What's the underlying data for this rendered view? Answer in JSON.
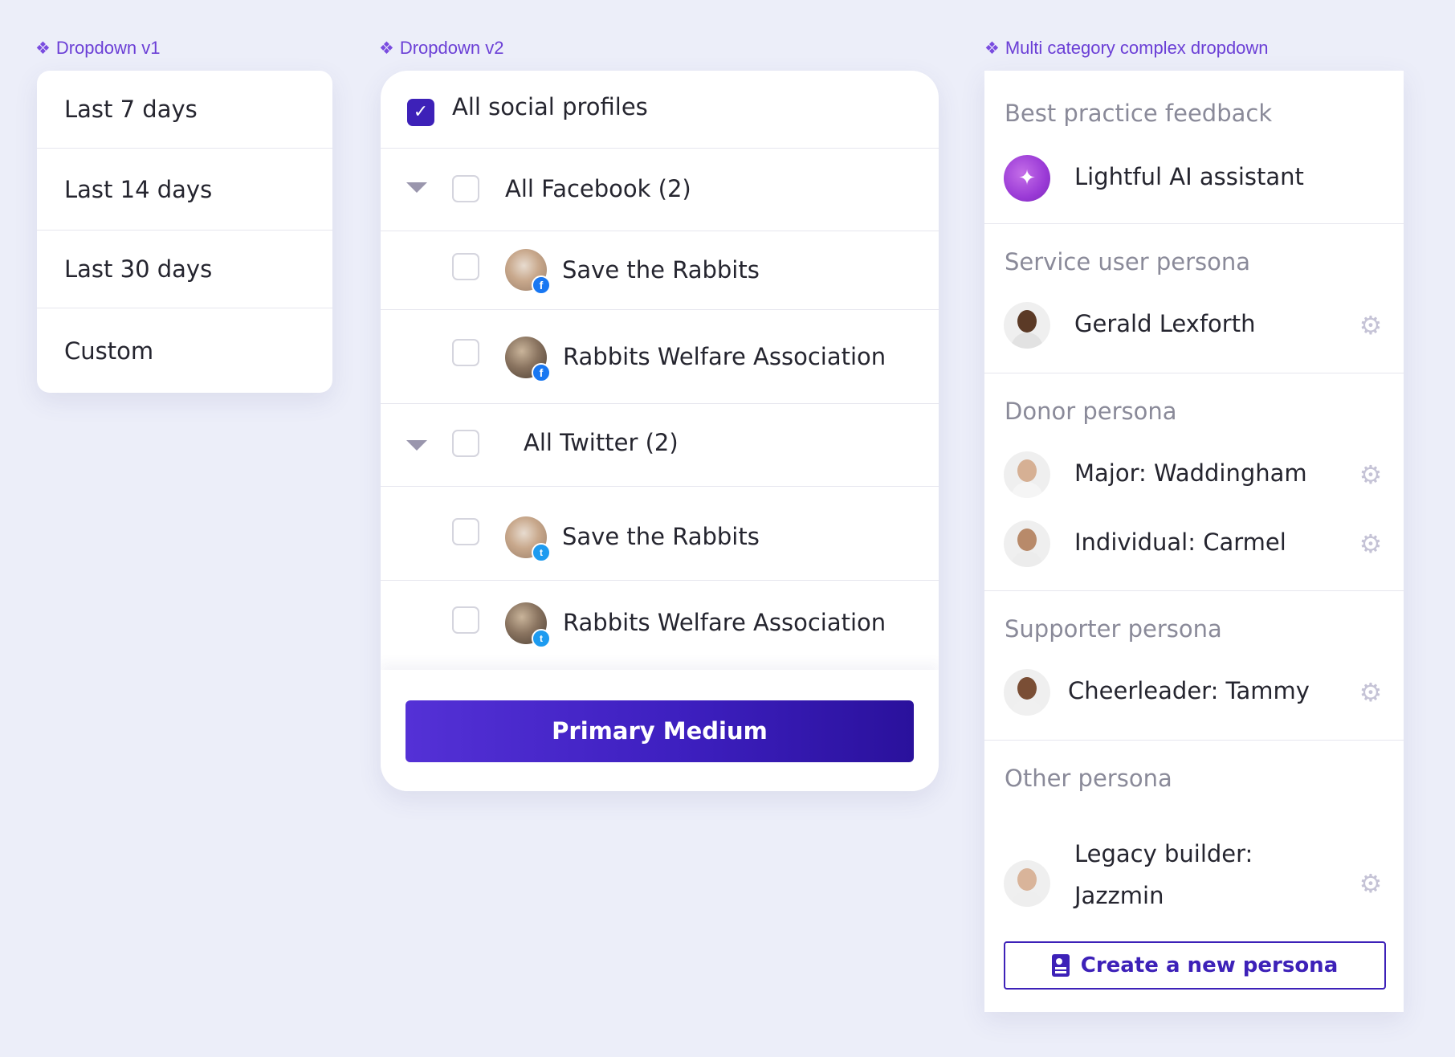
{
  "labels": {
    "dropdown_v1": "Dropdown v1",
    "dropdown_v2": "Dropdown v2",
    "multi_category": "Multi category complex dropdown"
  },
  "dropdown_v1": {
    "items": [
      "Last 7 days",
      "Last 14 days",
      "Last 30 days",
      "Custom"
    ]
  },
  "dropdown_v2": {
    "all_profiles": "All social profiles",
    "all_profiles_checked": true,
    "facebook_group": "All Facebook (2)",
    "facebook_items": [
      "Save the Rabbits",
      "Rabbits Welfare Association"
    ],
    "twitter_group": "All Twitter (2)",
    "twitter_items": [
      "Save the Rabbits",
      "Rabbits Welfare Association"
    ],
    "button": "Primary Medium",
    "fb_badge": "f",
    "tw_badge": "t"
  },
  "multi_category": {
    "categories": [
      {
        "title": "Best practice feedback",
        "items": [
          "Lightful AI assistant"
        ]
      },
      {
        "title": "Service user persona",
        "items": [
          "Gerald Lexforth"
        ]
      },
      {
        "title": "Donor persona",
        "items": [
          "Major: Waddingham",
          "Individual: Carmel"
        ]
      },
      {
        "title": "Supporter persona",
        "items": [
          "Cheerleader: Tammy"
        ]
      },
      {
        "title": "Other persona",
        "items": [
          "Legacy builder:",
          "Jazzmin"
        ]
      }
    ],
    "create_button": "Create a new persona"
  },
  "colors": {
    "accent": "#3d21b8",
    "label": "#6b3fd6",
    "background": "#eceef9"
  }
}
